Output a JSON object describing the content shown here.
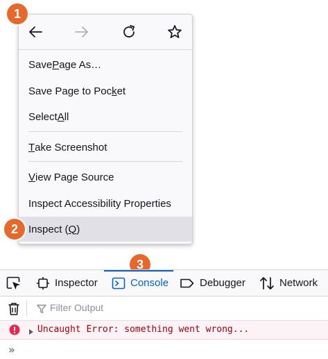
{
  "context_menu": {
    "items": [
      {
        "pre": "Save ",
        "u": "P",
        "post": "age As…"
      },
      {
        "pre": "Save Page to Poc",
        "u": "k",
        "post": "et"
      },
      {
        "pre": "Select ",
        "u": "A",
        "post": "ll"
      },
      {
        "pre": "",
        "u": "T",
        "post": "ake Screenshot"
      },
      {
        "pre": "",
        "u": "V",
        "post": "iew Page Source"
      },
      {
        "pre": "Inspect Accessibility Properties",
        "u": "",
        "post": ""
      },
      {
        "pre": "Inspect (",
        "u": "Q",
        "post": ")"
      }
    ]
  },
  "badges": [
    "1",
    "2",
    "3"
  ],
  "devtools": {
    "tabs": [
      "Inspector",
      "Console",
      "Debugger",
      "Network"
    ],
    "filter_placeholder": "Filter Output",
    "error_message": "Uncaught Error: something went wrong...",
    "prompt_symbol": "»"
  },
  "colors": {
    "badge": "#e8682c",
    "accent": "#0060df",
    "error_text": "#a4000f",
    "error_bg": "#fdf2f5",
    "error_icon": "#e22850"
  }
}
